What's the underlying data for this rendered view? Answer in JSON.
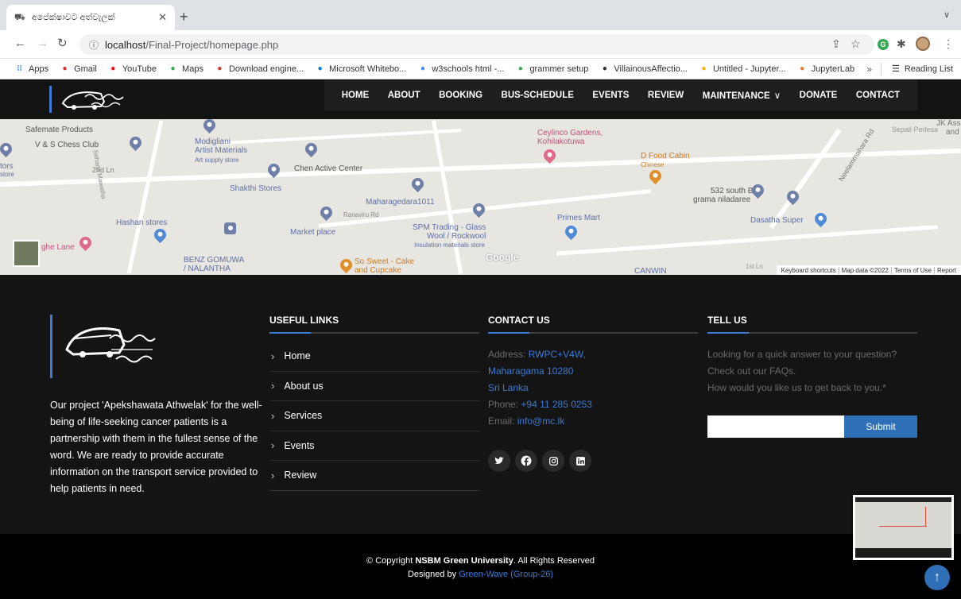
{
  "browser": {
    "tab_title": "අපේක්ෂාවට අත්වැලක්",
    "url_host": "localhost",
    "url_path": "/Final-Project/homepage.php",
    "bookmarks": [
      {
        "label": "Apps",
        "icon": "apps-grid-icon",
        "color": "#4285f4"
      },
      {
        "label": "Gmail",
        "icon": "gmail-icon",
        "color": "#d93025"
      },
      {
        "label": "YouTube",
        "icon": "youtube-icon",
        "color": "#ff0000"
      },
      {
        "label": "Maps",
        "icon": "maps-icon",
        "color": "#34a853"
      },
      {
        "label": "Download engine...",
        "icon": "download-engine-icon",
        "color": "#d93025"
      },
      {
        "label": "Microsoft Whitebo...",
        "icon": "whiteboard-icon",
        "color": "#0078d4"
      },
      {
        "label": "w3schools html -...",
        "icon": "google-icon",
        "color": "#4285f4"
      },
      {
        "label": "grammer setup",
        "icon": "grammer-icon",
        "color": "#34a853"
      },
      {
        "label": "VillainousAffectio...",
        "icon": "villainous-icon",
        "color": "#333333"
      },
      {
        "label": "Untitled - Jupyter...",
        "icon": "jupyter-icon",
        "color": "#f5b400"
      },
      {
        "label": "JupyterLab",
        "icon": "jupyterlab-icon",
        "color": "#f37726"
      }
    ],
    "bookmarks_more": "»",
    "reading_list": "Reading List"
  },
  "nav": {
    "items": [
      "HOME",
      "ABOUT",
      "BOOKING",
      "BUS-SCHEDULE",
      "EVENTS",
      "REVIEW",
      "MAINTENANCE",
      "DONATE",
      "CONTACT"
    ],
    "dropdown_marker": "∨"
  },
  "map": {
    "places": [
      "Safemate Products",
      "V & S Chess Club",
      "Modigliani",
      "Artist Materials",
      "Art supply store",
      "2nd Ln",
      "Chen Active Center",
      "Shakthi Stores",
      "Maharagedara1011",
      "Ranaviru Rd",
      "Hashan stores",
      "Market place",
      "SPM Trading - Glass",
      "Wool / Rockwool",
      "Insulation materials store",
      "ghe Lane",
      "BENZ GOMUWA",
      "/ NALANTHA",
      "So Sweet - Cake",
      "and Cupcake",
      "Ceylinco Gardens,",
      "Kohilakotuwa",
      "D Food Cabin",
      "Chinese",
      "Primes Mart",
      "532 south B",
      "grama niladaree",
      "Dasatha Super",
      "CANWIN",
      "Neelammahara Rd",
      "Sepali Pedesa",
      "JK Asso",
      "and",
      "Sehada Mawatha",
      "tors",
      "store",
      "1st Ln"
    ],
    "google": "Google",
    "attribution": [
      "Keyboard shortcuts",
      "Map data ©2022",
      "Terms of Use",
      "Report"
    ]
  },
  "footer": {
    "about": "Our project 'Apekshawata Athwelak' for the well-being of life-seeking cancer patients is a partnership with them in the fullest sense of the word. We are ready to provide accurate information on the transport service provided to help patients in need.",
    "useful_links_title": "USEFUL LINKS",
    "useful_links": [
      "Home",
      "About us",
      "Services",
      "Events",
      "Review"
    ],
    "contact_title": "CONTACT US",
    "address_label": "Address:",
    "address_line1": "RWPC+V4W,",
    "address_line2": "Maharagama 10280",
    "address_line3": "Sri Lanka",
    "phone_label": "Phone:",
    "phone": "+94 11 285 0253",
    "email_label": "Email:",
    "email": "info@mc.lk",
    "socials": [
      "twitter-icon",
      "facebook-icon",
      "instagram-icon",
      "linkedin-icon"
    ],
    "tell_title": "TELL US",
    "tell_line1": "Looking for a quick answer to your question?",
    "tell_line2": "Check out our FAQs.",
    "tell_line3": "How would you like us to get back to you.*",
    "input_value": "",
    "submit": "Submit"
  },
  "copyright": {
    "prefix": "© Copyright",
    "company": "NSBM Green University",
    "suffix": ". All Rights Reserved",
    "designed_by": "Designed by",
    "designer": "Green-Wave (Group-26)"
  },
  "colors": {
    "accent": "#3a7bd5",
    "footer_bg": "#141414",
    "button": "#2e6fb7"
  }
}
